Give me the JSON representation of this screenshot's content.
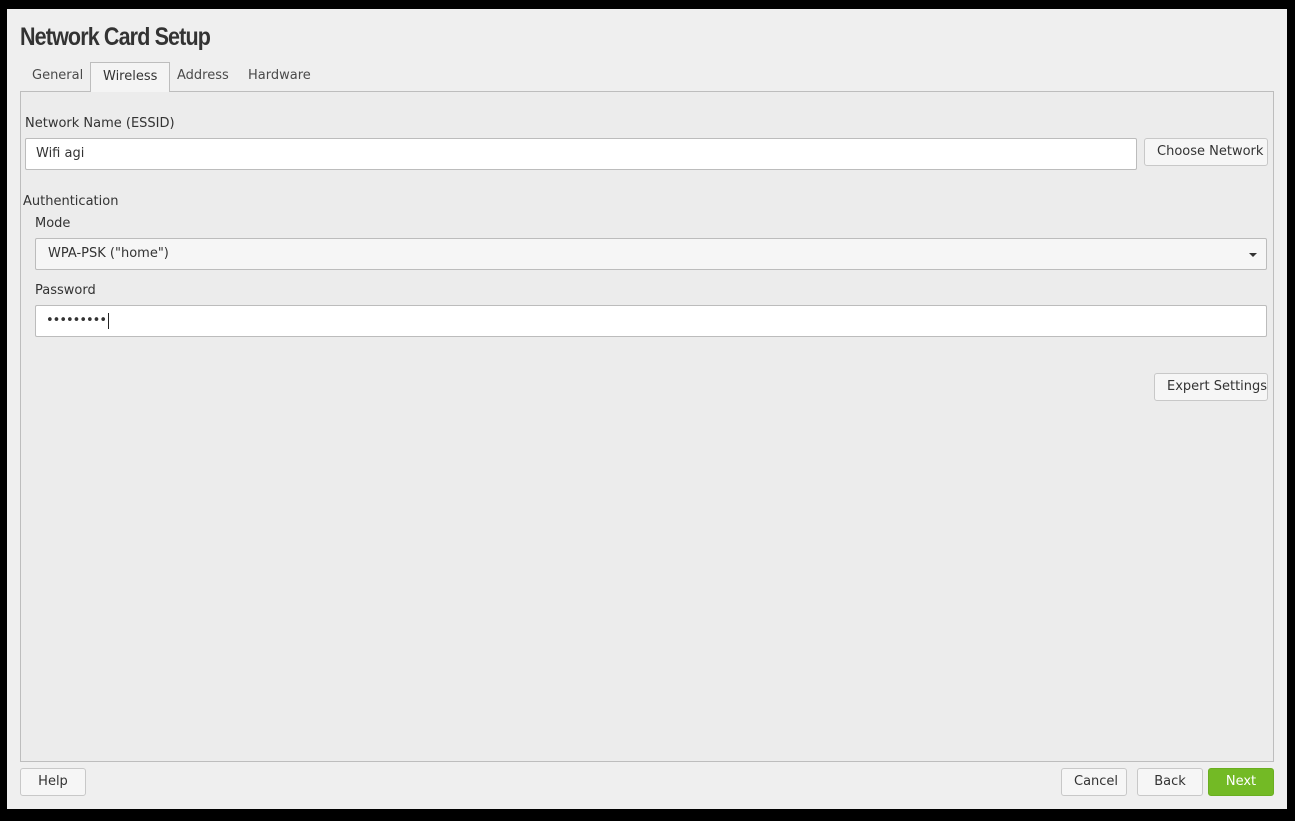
{
  "window": {
    "title": "Network Card Setup",
    "theme_icon": "half-moon-icon"
  },
  "tabs": [
    {
      "label": "General",
      "active": false
    },
    {
      "label": "Wireless",
      "active": true
    },
    {
      "label": "Address",
      "active": false
    },
    {
      "label": "Hardware",
      "active": false
    }
  ],
  "wireless": {
    "essid_label": "Network Name (ESSID)",
    "essid_value": "Wifi agi",
    "choose_network_label": "Choose Network",
    "auth_heading": "Authentication",
    "mode_label": "Mode",
    "mode_value": "WPA-PSK (\"home\")",
    "password_label": "Password",
    "password_value": "•••••••••",
    "expert_settings_label": "Expert Settings"
  },
  "footer": {
    "help_label": "Help",
    "cancel_label": "Cancel",
    "back_label": "Back",
    "next_label": "Next"
  },
  "colors": {
    "accent": "#73ba25",
    "background": "#efefef"
  }
}
